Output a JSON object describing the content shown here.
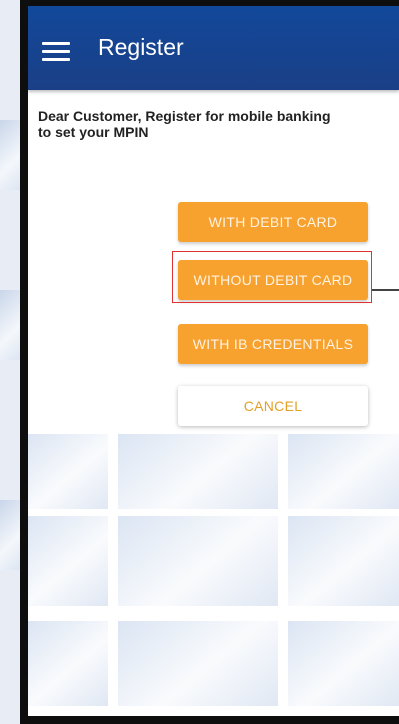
{
  "header": {
    "title": "Register",
    "menu_icon": "hamburger-menu-icon",
    "background": "#1a4a95"
  },
  "message": "Dear Customer, Register for mobile banking to set your MPIN",
  "buttons": {
    "with_debit_card": "WITH DEBIT CARD",
    "without_debit_card": "WITHOUT DEBIT CARD",
    "with_ib_credentials": "WITH IB CREDENTIALS",
    "cancel": "CANCEL"
  },
  "colors": {
    "accent": "#f7a12e",
    "highlight": "#e0332f"
  }
}
